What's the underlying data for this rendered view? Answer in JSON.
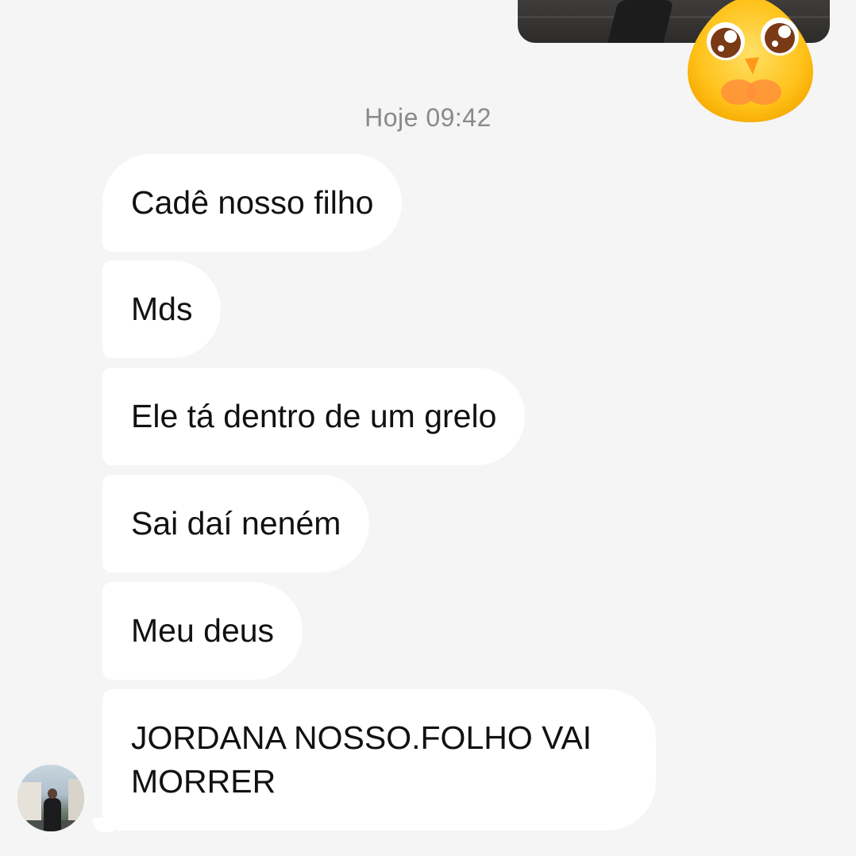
{
  "conversation": {
    "timestamp": "Hoje 09:42",
    "messages": [
      {
        "text": "Cadê nosso filho"
      },
      {
        "text": "Mds"
      },
      {
        "text": "Ele tá dentro de um grelo"
      },
      {
        "text": "Sai daí neném"
      },
      {
        "text": "Meu deus"
      },
      {
        "text": "JORDANA NOSSO.FOLHO VAI MORRER"
      }
    ]
  },
  "sent_image": {
    "icon": "photo-thumbnail"
  },
  "reaction": {
    "icon": "chick-emoji-icon"
  },
  "avatar": {
    "icon": "contact-avatar"
  },
  "colors": {
    "background": "#f5f5f5",
    "bubble": "#ffffff",
    "text": "#111111",
    "timestamp": "#8a8a8a"
  }
}
